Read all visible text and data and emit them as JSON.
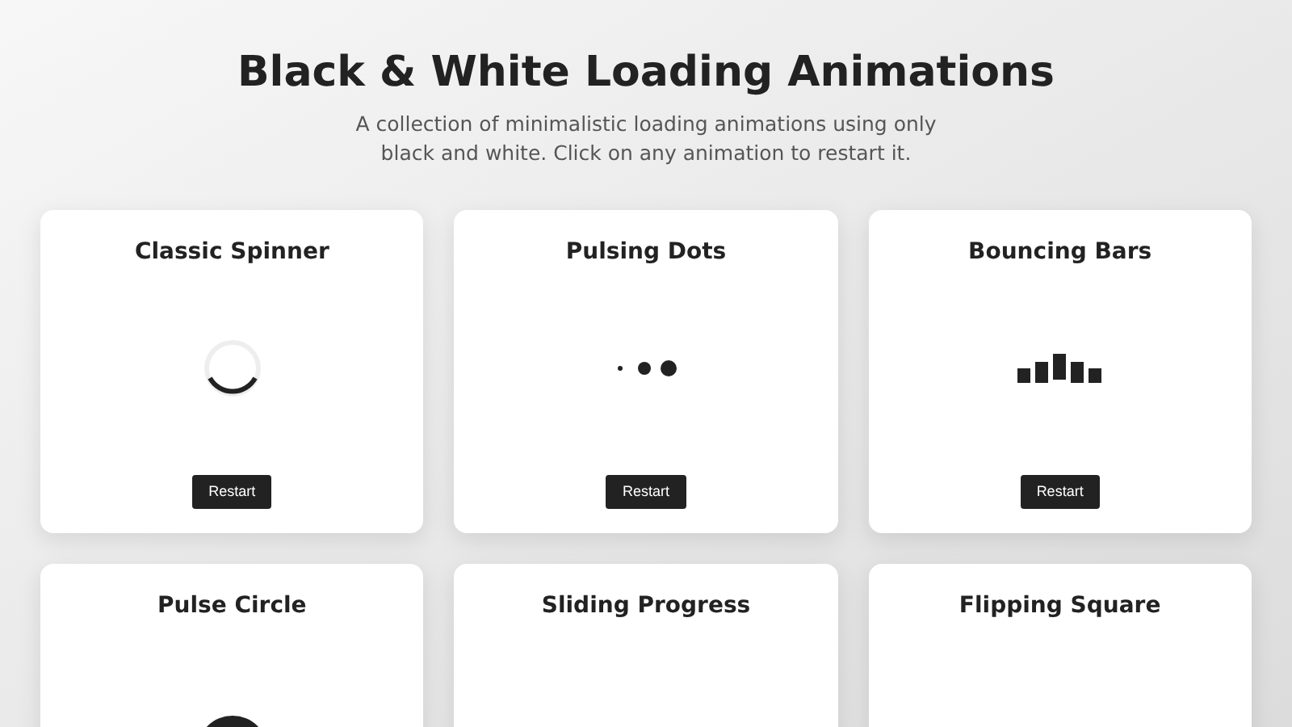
{
  "header": {
    "title": "Black & White Loading Animations",
    "subtitle": "A collection of minimalistic loading animations using only black and white. Click on any animation to restart it."
  },
  "cards": [
    {
      "kind": "spinner",
      "title": "Classic Spinner",
      "button": "Restart"
    },
    {
      "kind": "dots",
      "title": "Pulsing Dots",
      "button": "Restart"
    },
    {
      "kind": "bars",
      "title": "Bouncing Bars",
      "button": "Restart"
    },
    {
      "kind": "pulse",
      "title": "Pulse Circle"
    },
    {
      "kind": "sliding",
      "title": "Sliding Progress"
    },
    {
      "kind": "flipping",
      "title": "Flipping Square"
    }
  ]
}
